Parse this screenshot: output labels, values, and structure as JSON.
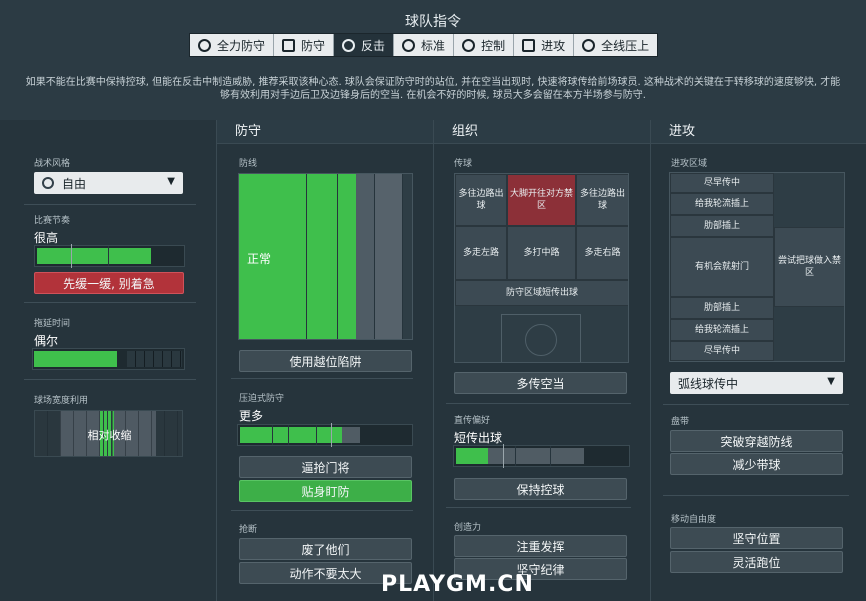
{
  "header": {
    "title": "球队指令"
  },
  "tabs": [
    {
      "label": "全力防守",
      "icon": "heart-shield-icon"
    },
    {
      "label": "防守",
      "icon": "shield-icon"
    },
    {
      "label": "反击",
      "icon": "counter-icon"
    },
    {
      "label": "标准",
      "icon": "balance-icon"
    },
    {
      "label": "控制",
      "icon": "control-icon"
    },
    {
      "label": "进攻",
      "icon": "attack-arrow-icon"
    },
    {
      "label": "全线压上",
      "icon": "all-out-icon"
    }
  ],
  "description": "如果不能在比赛中保持控球, 但能在反击中制造威胁, 推荐采取该种心态. 球队会保证防守时的站位, 并在空当出现时, 快速将球传给前场球员. 这种战术的关键在于转移球的速度够快, 才能够有效利用对手边后卫及边锋身后的空当. 在机会不好的时候, 球员大多会留在本方半场参与防守.",
  "general": {
    "style_label": "战术风格",
    "style_value": "自由",
    "tempo_label": "比赛节奏",
    "tempo_value": "很高",
    "tempo_level": 0.8,
    "tempo_button": "先缓一缓, 别着急",
    "timewaste_label": "拖延时间",
    "timewaste_value": "偶尔",
    "timewaste_level": 0.55,
    "width_label": "球场宽度利用",
    "width_value": "相对收缩"
  },
  "defence": {
    "head": "防守",
    "line_label": "防线",
    "line_value": "正常",
    "offside_button": "使用越位陷阱",
    "press_label": "压迫式防守",
    "press_value": "更多",
    "press_level": 0.62,
    "press_buttons": [
      "逼抢门将",
      "贴身盯防"
    ],
    "tackle_label": "抢断",
    "tackle_buttons": [
      "废了他们",
      "动作不要太大"
    ]
  },
  "organise": {
    "head": "组织",
    "pass_label": "传球",
    "zones": {
      "tl": "多往边路出球",
      "tc": "大脚开往对方禁区",
      "tr": "多往边路出球",
      "ml": "多走左路",
      "mc": "多打中路",
      "mr": "多走右路",
      "bottom": "防守区域短传出球"
    },
    "pass_button": "多传空当",
    "pref_label": "直传偏好",
    "pref_value": "短传出球",
    "pref_level": 0.45,
    "pref_button": "保持控球",
    "creative_label": "创造力",
    "creative_buttons": [
      "注重发挥",
      "坚守纪律"
    ]
  },
  "attack": {
    "head": "进攻",
    "zone_label": "进攻区域",
    "zones": [
      "尽早传中",
      "给我轮流插上",
      "肋部插上",
      "有机会就射门",
      "尝试把球做入禁区",
      "肋部插上",
      "给我轮流插上",
      "尽早传中"
    ],
    "cross_value": "弧线球传中",
    "dribble_label": "盘带",
    "dribble_buttons": [
      "突破穿越防线",
      "减少带球"
    ],
    "freedom_label": "移动自由度",
    "freedom_buttons": [
      "坚守位置",
      "灵活跑位"
    ]
  },
  "watermark": "PLAYGM.CN",
  "colors": {
    "accent_green": "#3daf48",
    "accent_red": "#b2333a",
    "panel": "#26343c"
  }
}
